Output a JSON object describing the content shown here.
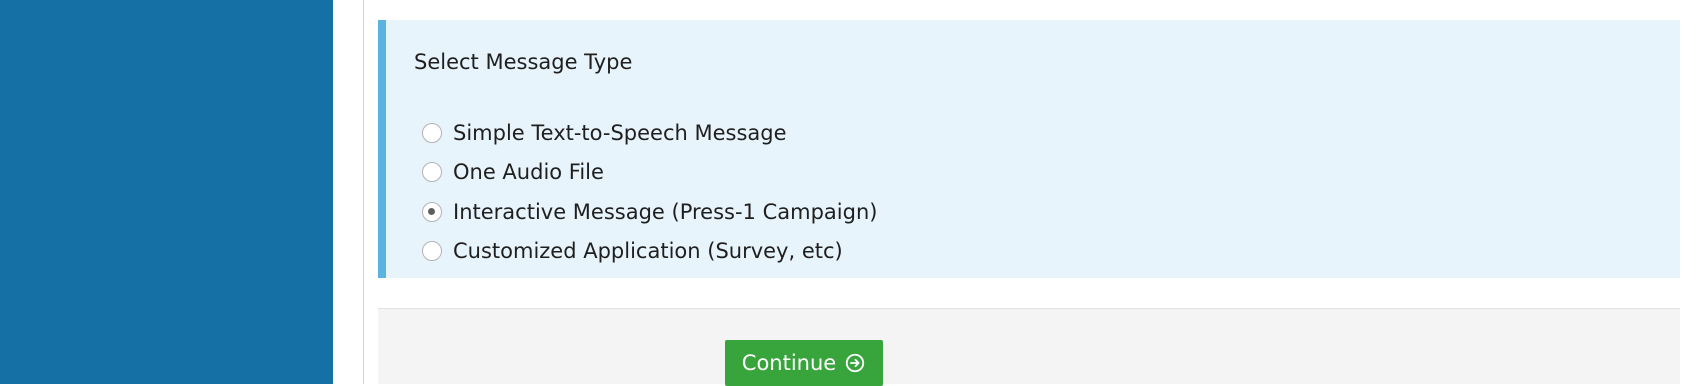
{
  "layout": {
    "sidebar_color": "#1570a6",
    "panel_background": "#e8f4fb",
    "panel_accent": "#5bb4df",
    "action_background": "#f4f4f4"
  },
  "message_type": {
    "title": "Select Message Type",
    "options": [
      {
        "label": "Simple Text-to-Speech Message",
        "selected": false
      },
      {
        "label": "One Audio File",
        "selected": false
      },
      {
        "label": "Interactive Message (Press-1 Campaign)",
        "selected": true
      },
      {
        "label": "Customized Application (Survey, etc)",
        "selected": false
      }
    ],
    "selected_value": "Interactive Message (Press-1 Campaign)"
  },
  "actions": {
    "continue_label": "Continue",
    "continue_icon": "arrow-right-circle-icon",
    "continue_color": "#38a53c"
  }
}
